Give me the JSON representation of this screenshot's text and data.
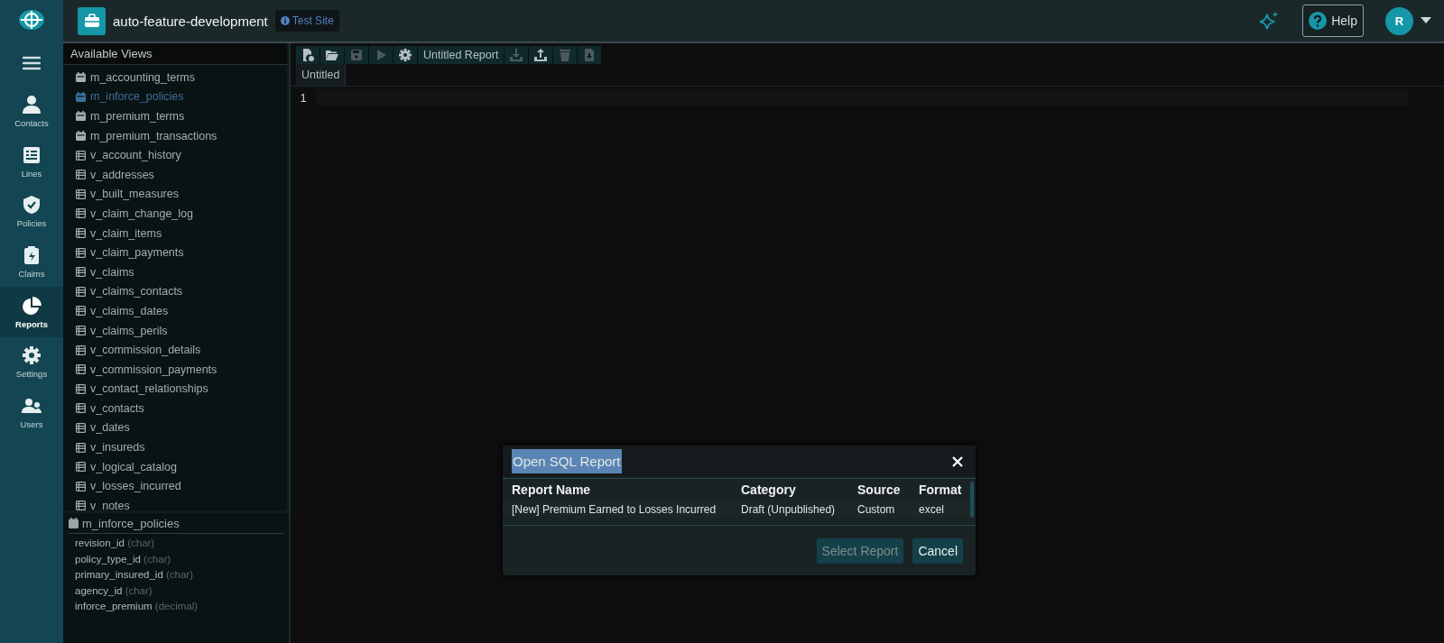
{
  "header": {
    "project": "auto-feature-development",
    "site_badge": "Test Site",
    "help": "Help",
    "avatar": "R"
  },
  "nav": [
    {
      "label": "Contacts",
      "selected": false
    },
    {
      "label": "Lines",
      "selected": false
    },
    {
      "label": "Policies",
      "selected": false
    },
    {
      "label": "Claims",
      "selected": false
    },
    {
      "label": "Reports",
      "selected": true
    },
    {
      "label": "Settings",
      "selected": false
    },
    {
      "label": "Users",
      "selected": false
    }
  ],
  "views": {
    "title": "Available Views",
    "items": [
      {
        "name": "m_accounting_terms",
        "kind": "matview",
        "selected": false
      },
      {
        "name": "m_inforce_policies",
        "kind": "matview",
        "selected": true
      },
      {
        "name": "m_premium_terms",
        "kind": "matview",
        "selected": false
      },
      {
        "name": "m_premium_transactions",
        "kind": "matview",
        "selected": false
      },
      {
        "name": "v_account_history",
        "kind": "view",
        "selected": false
      },
      {
        "name": "v_addresses",
        "kind": "view",
        "selected": false
      },
      {
        "name": "v_built_measures",
        "kind": "view",
        "selected": false
      },
      {
        "name": "v_claim_change_log",
        "kind": "view",
        "selected": false
      },
      {
        "name": "v_claim_items",
        "kind": "view",
        "selected": false
      },
      {
        "name": "v_claim_payments",
        "kind": "view",
        "selected": false
      },
      {
        "name": "v_claims",
        "kind": "view",
        "selected": false
      },
      {
        "name": "v_claims_contacts",
        "kind": "view",
        "selected": false
      },
      {
        "name": "v_claims_dates",
        "kind": "view",
        "selected": false
      },
      {
        "name": "v_claims_perils",
        "kind": "view",
        "selected": false
      },
      {
        "name": "v_commission_details",
        "kind": "view",
        "selected": false
      },
      {
        "name": "v_commission_payments",
        "kind": "view",
        "selected": false
      },
      {
        "name": "v_contact_relationships",
        "kind": "view",
        "selected": false
      },
      {
        "name": "v_contacts",
        "kind": "view",
        "selected": false
      },
      {
        "name": "v_dates",
        "kind": "view",
        "selected": false
      },
      {
        "name": "v_insureds",
        "kind": "view",
        "selected": false
      },
      {
        "name": "v_logical_catalog",
        "kind": "view",
        "selected": false
      },
      {
        "name": "v_losses_incurred",
        "kind": "view",
        "selected": false
      },
      {
        "name": "v_notes",
        "kind": "view",
        "selected": false
      }
    ]
  },
  "fields": {
    "title": "m_inforce_policies",
    "items": [
      {
        "name": "revision_id",
        "type": "(char)"
      },
      {
        "name": "policy_type_id",
        "type": "(char)"
      },
      {
        "name": "primary_insured_id",
        "type": "(char)"
      },
      {
        "name": "agency_id",
        "type": "(char)"
      },
      {
        "name": "inforce_premium",
        "type": "(decimal)"
      }
    ]
  },
  "toolbar": [
    {
      "kind": "new",
      "disabled": false
    },
    {
      "kind": "open",
      "disabled": false
    },
    {
      "kind": "save",
      "disabled": true
    },
    {
      "kind": "run",
      "disabled": true
    },
    {
      "kind": "settings",
      "disabled": false
    },
    {
      "kind": "title",
      "label": "Untitled Report"
    },
    {
      "kind": "download",
      "disabled": true
    },
    {
      "kind": "upload",
      "disabled": false
    },
    {
      "kind": "delete",
      "disabled": true
    },
    {
      "kind": "export",
      "disabled": true
    }
  ],
  "editor": {
    "tab": "Untitled",
    "line_numbers": [
      "1"
    ]
  },
  "dialog": {
    "title": "Open SQL Report",
    "title_selected": true,
    "columns": [
      "Report Name",
      "Category",
      "Source",
      "Format"
    ],
    "rows": [
      {
        "cells": [
          "[New] Premium Earned to Losses Incurred",
          "Draft (Unpublished)",
          "Custom",
          "excel"
        ],
        "selected": false
      }
    ],
    "buttons": [
      {
        "label": "Select Report",
        "disabled": true
      },
      {
        "label": "Cancel",
        "disabled": false
      }
    ]
  }
}
